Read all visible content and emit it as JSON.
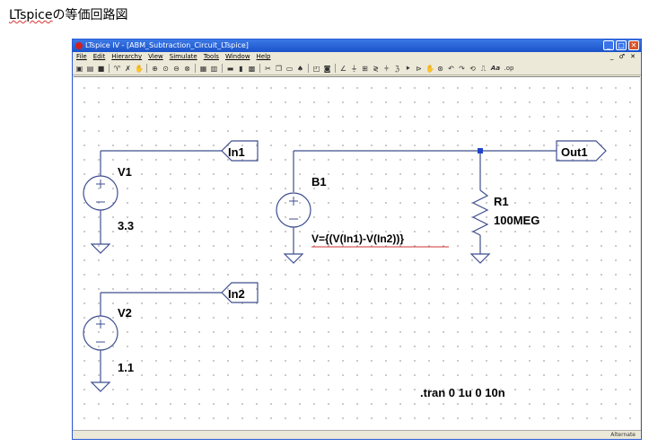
{
  "caption": {
    "brand": "LTspice",
    "rest": "の等価回路図"
  },
  "window": {
    "title": "LTspice IV - [ABM_Subtraction_Circuit_LTspice]"
  },
  "menu": [
    "File",
    "Edit",
    "Hierarchy",
    "View",
    "Simulate",
    "Tools",
    "Window",
    "Help"
  ],
  "menu_right": "_ ♂ ✕",
  "toolbar_icons": [
    "new-schematic",
    "open",
    "save",
    "control-panel",
    "run",
    "halt",
    "zoom-in",
    "pan",
    "zoom-out",
    "zoom-fit",
    "autoscale",
    "tile-h",
    "tile-v",
    "close-window",
    "cut",
    "copy",
    "paste",
    "find",
    "print-preview",
    "print",
    "wire",
    "ground",
    "label",
    "resistor",
    "capacitor",
    "inductor",
    "diode",
    "component",
    "move",
    "drag",
    "undo",
    "redo",
    "rotate",
    "mirror",
    "text",
    "spice-directive"
  ],
  "schematic": {
    "labels": {
      "in1": "In1",
      "in2": "In2",
      "out1": "Out1"
    },
    "v1": {
      "name": "V1",
      "value": "3.3"
    },
    "v2": {
      "name": "V2",
      "value": "1.1"
    },
    "b1": {
      "name": "B1",
      "expr": "V={(V(In1)-V(In2))}"
    },
    "r1": {
      "name": "R1",
      "value": "100MEG"
    },
    "directive": ".tran 0 1u 0 10n"
  },
  "status": "Alternate"
}
